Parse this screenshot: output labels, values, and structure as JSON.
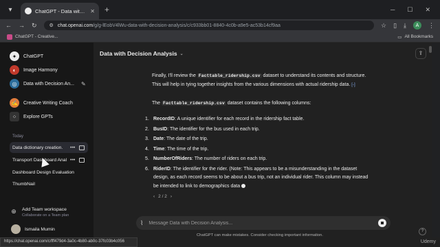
{
  "browser": {
    "tab_title": "ChatGPT - Data with Decision A",
    "new_tab": "+",
    "url_host": "chat.openai.com",
    "url_path": "/g/g-lEobV4lWu-data-with-decision-analysis/c/c933bb01-8840-4c0b-a9e5-ac53b14cf9aa",
    "bookmark": "ChatGPT - Creative...",
    "all_bookmarks": "All Bookmarks",
    "profile_initial": "A",
    "status_url": "https://chat.openai.com/c/fff479d4-3a0c-4b80-ab0c-37fc03b4c056"
  },
  "sidebar": {
    "items": [
      {
        "label": "ChatGPT",
        "icon": "openai-logo-icon",
        "color": "#ffffff"
      },
      {
        "label": "Image Harmony",
        "icon": "image-harmony-avatar-icon",
        "color": "#c0392b"
      },
      {
        "label": "Data with Decision An...",
        "icon": "data-decision-avatar-icon",
        "color": "#2c6e9c"
      },
      {
        "label": "Creative Writing Coach",
        "icon": "writing-coach-avatar-icon",
        "color": "#e07b3c"
      },
      {
        "label": "Explore GPTs",
        "icon": "grid-icon",
        "color": "#444444"
      }
    ],
    "section_today": "Today",
    "conversations": [
      {
        "label": "Data dictionary creation."
      },
      {
        "label": "Transport Dashboard Anal"
      },
      {
        "label": "Dashboard Design Evaluation"
      },
      {
        "label": "ThumbNail"
      }
    ],
    "team_title": "Add Team workspace",
    "team_subtitle": "Collaborate on a Team plan",
    "user_name": "Ismaila Mumin"
  },
  "main": {
    "title": "Data with Decision Analysis",
    "para1_a": "Finally, I'll review the",
    "para1_code": "Facttable_ridership.csv",
    "para1_b": "dataset to understand its contents and",
    "para1_c": "structure. This will help in tying together insights from the various dimensions with actual",
    "para1_d": "ridership data.",
    "para1_ref": "[-]",
    "para2_a": "The",
    "para2_code": "Facttable_ridership.csv",
    "para2_b": "dataset contains the following columns:",
    "columns": [
      {
        "num": "1.",
        "name": "RecordID",
        "desc": ": A unique identifier for each record in the ridership fact table."
      },
      {
        "num": "2.",
        "name": "BusID",
        "desc": ": The identifier for the bus used in each trip."
      },
      {
        "num": "3.",
        "name": "Date",
        "desc": ": The date of the trip."
      },
      {
        "num": "4.",
        "name": "Time",
        "desc": ": The time of the trip."
      },
      {
        "num": "5.",
        "name": "NumberOfRiders",
        "desc": ": The number of riders on each trip."
      },
      {
        "num": "6.",
        "name": "RiderID",
        "desc": ": The identifier for the rider. (Note: This appears to be a misunderstanding in the dataset design, as each record seems to be about a bus trip, not an individual rider. This column may instead be intended to link to demographics data"
      }
    ],
    "pager": "2 / 2",
    "pager_prev": "‹",
    "pager_next": "›",
    "composer_placeholder": "Message Data with Decision Analysis...",
    "disclaimer": "ChatGPT can make mistakes. Consider checking important information.",
    "help": "?"
  },
  "watermark": "Udemy"
}
